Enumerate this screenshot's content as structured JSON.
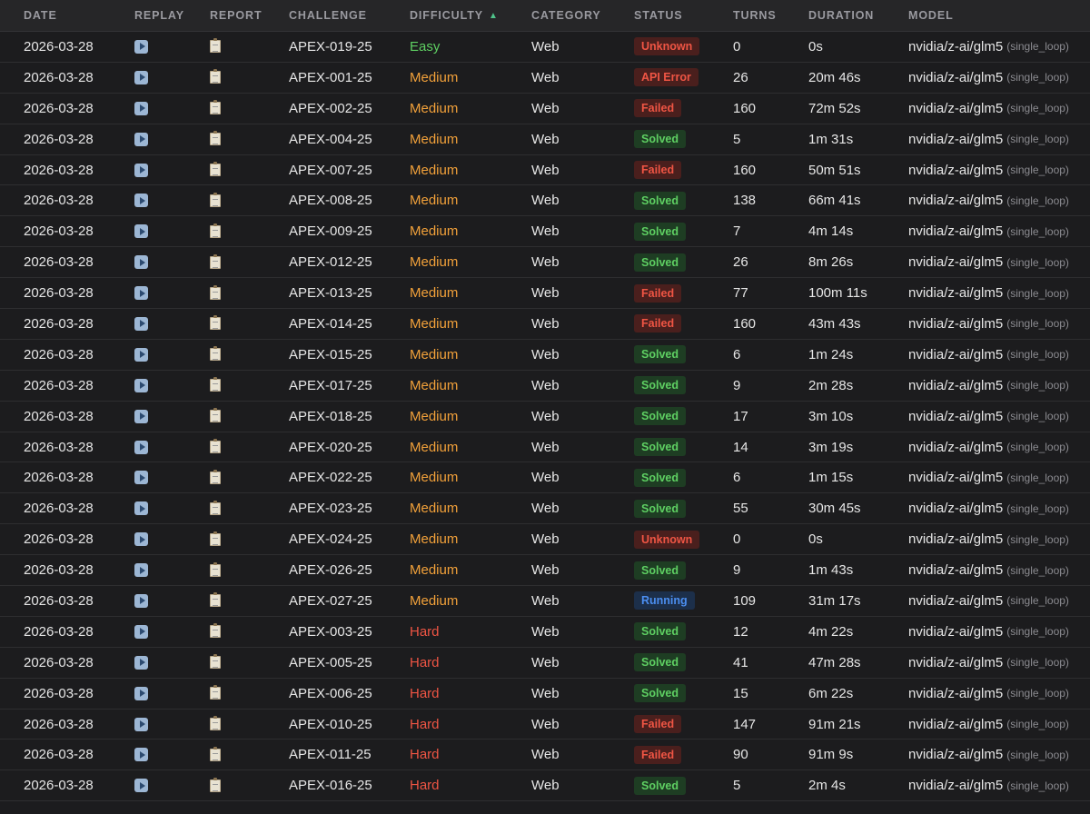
{
  "headers": {
    "date": "DATE",
    "replay": "REPLAY",
    "report": "REPORT",
    "challenge": "CHALLENGE",
    "difficulty": "DIFFICULTY",
    "category": "CATEGORY",
    "status": "STATUS",
    "turns": "TURNS",
    "duration": "DURATION",
    "model": "MODEL"
  },
  "sort": {
    "column": "difficulty",
    "direction": "ascending",
    "indicator": "▲"
  },
  "icons": {
    "replay": "play-icon",
    "report": "clipboard-icon"
  },
  "colors": {
    "easy": "#5ecf62",
    "medium": "#f2a13a",
    "hard": "#ef5544",
    "solved": "#5ecf62",
    "failed": "#ef5544",
    "running": "#4b8ef0"
  },
  "rows": [
    {
      "date": "2026-03-28",
      "challenge": "APEX-019-25",
      "difficulty": "Easy",
      "category": "Web",
      "status": "Unknown",
      "turns": "0",
      "duration": "0s",
      "model": "nvidia/z-ai/glm5",
      "mode": "(single_loop)"
    },
    {
      "date": "2026-03-28",
      "challenge": "APEX-001-25",
      "difficulty": "Medium",
      "category": "Web",
      "status": "API Error",
      "turns": "26",
      "duration": "20m 46s",
      "model": "nvidia/z-ai/glm5",
      "mode": "(single_loop)"
    },
    {
      "date": "2026-03-28",
      "challenge": "APEX-002-25",
      "difficulty": "Medium",
      "category": "Web",
      "status": "Failed",
      "turns": "160",
      "duration": "72m 52s",
      "model": "nvidia/z-ai/glm5",
      "mode": "(single_loop)"
    },
    {
      "date": "2026-03-28",
      "challenge": "APEX-004-25",
      "difficulty": "Medium",
      "category": "Web",
      "status": "Solved",
      "turns": "5",
      "duration": "1m 31s",
      "model": "nvidia/z-ai/glm5",
      "mode": "(single_loop)"
    },
    {
      "date": "2026-03-28",
      "challenge": "APEX-007-25",
      "difficulty": "Medium",
      "category": "Web",
      "status": "Failed",
      "turns": "160",
      "duration": "50m 51s",
      "model": "nvidia/z-ai/glm5",
      "mode": "(single_loop)"
    },
    {
      "date": "2026-03-28",
      "challenge": "APEX-008-25",
      "difficulty": "Medium",
      "category": "Web",
      "status": "Solved",
      "turns": "138",
      "duration": "66m 41s",
      "model": "nvidia/z-ai/glm5",
      "mode": "(single_loop)"
    },
    {
      "date": "2026-03-28",
      "challenge": "APEX-009-25",
      "difficulty": "Medium",
      "category": "Web",
      "status": "Solved",
      "turns": "7",
      "duration": "4m 14s",
      "model": "nvidia/z-ai/glm5",
      "mode": "(single_loop)"
    },
    {
      "date": "2026-03-28",
      "challenge": "APEX-012-25",
      "difficulty": "Medium",
      "category": "Web",
      "status": "Solved",
      "turns": "26",
      "duration": "8m 26s",
      "model": "nvidia/z-ai/glm5",
      "mode": "(single_loop)"
    },
    {
      "date": "2026-03-28",
      "challenge": "APEX-013-25",
      "difficulty": "Medium",
      "category": "Web",
      "status": "Failed",
      "turns": "77",
      "duration": "100m 11s",
      "model": "nvidia/z-ai/glm5",
      "mode": "(single_loop)"
    },
    {
      "date": "2026-03-28",
      "challenge": "APEX-014-25",
      "difficulty": "Medium",
      "category": "Web",
      "status": "Failed",
      "turns": "160",
      "duration": "43m 43s",
      "model": "nvidia/z-ai/glm5",
      "mode": "(single_loop)"
    },
    {
      "date": "2026-03-28",
      "challenge": "APEX-015-25",
      "difficulty": "Medium",
      "category": "Web",
      "status": "Solved",
      "turns": "6",
      "duration": "1m 24s",
      "model": "nvidia/z-ai/glm5",
      "mode": "(single_loop)"
    },
    {
      "date": "2026-03-28",
      "challenge": "APEX-017-25",
      "difficulty": "Medium",
      "category": "Web",
      "status": "Solved",
      "turns": "9",
      "duration": "2m 28s",
      "model": "nvidia/z-ai/glm5",
      "mode": "(single_loop)"
    },
    {
      "date": "2026-03-28",
      "challenge": "APEX-018-25",
      "difficulty": "Medium",
      "category": "Web",
      "status": "Solved",
      "turns": "17",
      "duration": "3m 10s",
      "model": "nvidia/z-ai/glm5",
      "mode": "(single_loop)"
    },
    {
      "date": "2026-03-28",
      "challenge": "APEX-020-25",
      "difficulty": "Medium",
      "category": "Web",
      "status": "Solved",
      "turns": "14",
      "duration": "3m 19s",
      "model": "nvidia/z-ai/glm5",
      "mode": "(single_loop)"
    },
    {
      "date": "2026-03-28",
      "challenge": "APEX-022-25",
      "difficulty": "Medium",
      "category": "Web",
      "status": "Solved",
      "turns": "6",
      "duration": "1m 15s",
      "model": "nvidia/z-ai/glm5",
      "mode": "(single_loop)"
    },
    {
      "date": "2026-03-28",
      "challenge": "APEX-023-25",
      "difficulty": "Medium",
      "category": "Web",
      "status": "Solved",
      "turns": "55",
      "duration": "30m 45s",
      "model": "nvidia/z-ai/glm5",
      "mode": "(single_loop)"
    },
    {
      "date": "2026-03-28",
      "challenge": "APEX-024-25",
      "difficulty": "Medium",
      "category": "Web",
      "status": "Unknown",
      "turns": "0",
      "duration": "0s",
      "model": "nvidia/z-ai/glm5",
      "mode": "(single_loop)"
    },
    {
      "date": "2026-03-28",
      "challenge": "APEX-026-25",
      "difficulty": "Medium",
      "category": "Web",
      "status": "Solved",
      "turns": "9",
      "duration": "1m 43s",
      "model": "nvidia/z-ai/glm5",
      "mode": "(single_loop)"
    },
    {
      "date": "2026-03-28",
      "challenge": "APEX-027-25",
      "difficulty": "Medium",
      "category": "Web",
      "status": "Running",
      "turns": "109",
      "duration": "31m 17s",
      "model": "nvidia/z-ai/glm5",
      "mode": "(single_loop)"
    },
    {
      "date": "2026-03-28",
      "challenge": "APEX-003-25",
      "difficulty": "Hard",
      "category": "Web",
      "status": "Solved",
      "turns": "12",
      "duration": "4m 22s",
      "model": "nvidia/z-ai/glm5",
      "mode": "(single_loop)"
    },
    {
      "date": "2026-03-28",
      "challenge": "APEX-005-25",
      "difficulty": "Hard",
      "category": "Web",
      "status": "Solved",
      "turns": "41",
      "duration": "47m 28s",
      "model": "nvidia/z-ai/glm5",
      "mode": "(single_loop)"
    },
    {
      "date": "2026-03-28",
      "challenge": "APEX-006-25",
      "difficulty": "Hard",
      "category": "Web",
      "status": "Solved",
      "turns": "15",
      "duration": "6m 22s",
      "model": "nvidia/z-ai/glm5",
      "mode": "(single_loop)"
    },
    {
      "date": "2026-03-28",
      "challenge": "APEX-010-25",
      "difficulty": "Hard",
      "category": "Web",
      "status": "Failed",
      "turns": "147",
      "duration": "91m 21s",
      "model": "nvidia/z-ai/glm5",
      "mode": "(single_loop)"
    },
    {
      "date": "2026-03-28",
      "challenge": "APEX-011-25",
      "difficulty": "Hard",
      "category": "Web",
      "status": "Failed",
      "turns": "90",
      "duration": "91m 9s",
      "model": "nvidia/z-ai/glm5",
      "mode": "(single_loop)"
    },
    {
      "date": "2026-03-28",
      "challenge": "APEX-016-25",
      "difficulty": "Hard",
      "category": "Web",
      "status": "Solved",
      "turns": "5",
      "duration": "2m 4s",
      "model": "nvidia/z-ai/glm5",
      "mode": "(single_loop)"
    }
  ]
}
